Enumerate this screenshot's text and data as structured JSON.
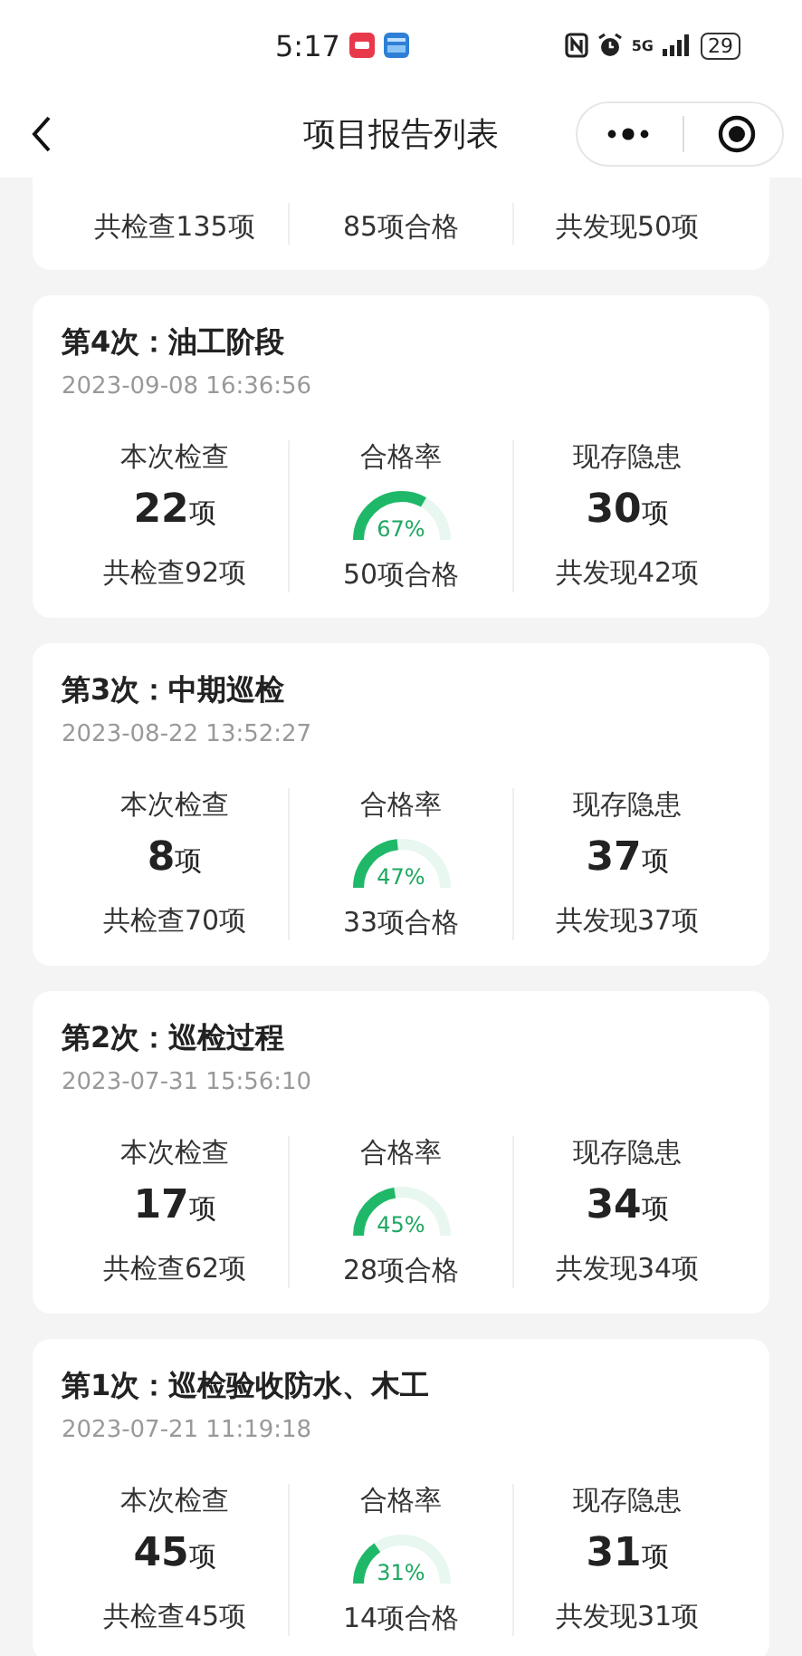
{
  "status_bar": {
    "time": "5:17",
    "network": "5G",
    "battery": "29"
  },
  "nav": {
    "title": "项目报告列表"
  },
  "partial_report": {
    "total_checked": "共检查135项",
    "passed": "85项合格",
    "total_found": "共发现50项"
  },
  "reports": [
    {
      "title": "第4次：油工阶段",
      "date": "2023-09-08 16:36:56",
      "check_label": "本次检查",
      "check_num": "22",
      "check_unit": "项",
      "rate_label": "合格率",
      "rate": "67%",
      "hazard_label": "现存隐患",
      "hazard_num": "30",
      "hazard_unit": "项",
      "total_checked": "共检查92项",
      "passed": "50项合格",
      "total_found": "共发现42项"
    },
    {
      "title": "第3次：中期巡检",
      "date": "2023-08-22 13:52:27",
      "check_label": "本次检查",
      "check_num": "8",
      "check_unit": "项",
      "rate_label": "合格率",
      "rate": "47%",
      "hazard_label": "现存隐患",
      "hazard_num": "37",
      "hazard_unit": "项",
      "total_checked": "共检查70项",
      "passed": "33项合格",
      "total_found": "共发现37项"
    },
    {
      "title": "第2次：巡检过程",
      "date": "2023-07-31 15:56:10",
      "check_label": "本次检查",
      "check_num": "17",
      "check_unit": "项",
      "rate_label": "合格率",
      "rate": "45%",
      "hazard_label": "现存隐患",
      "hazard_num": "34",
      "hazard_unit": "项",
      "total_checked": "共检查62项",
      "passed": "28项合格",
      "total_found": "共发现34项"
    },
    {
      "title": "第1次：巡检验收防水、木工",
      "date": "2023-07-21 11:19:18",
      "check_label": "本次检查",
      "check_num": "45",
      "check_unit": "项",
      "rate_label": "合格率",
      "rate": "31%",
      "hazard_label": "现存隐患",
      "hazard_num": "31",
      "hazard_unit": "项",
      "total_checked": "共检查45项",
      "passed": "14项合格",
      "total_found": "共发现31项"
    }
  ]
}
